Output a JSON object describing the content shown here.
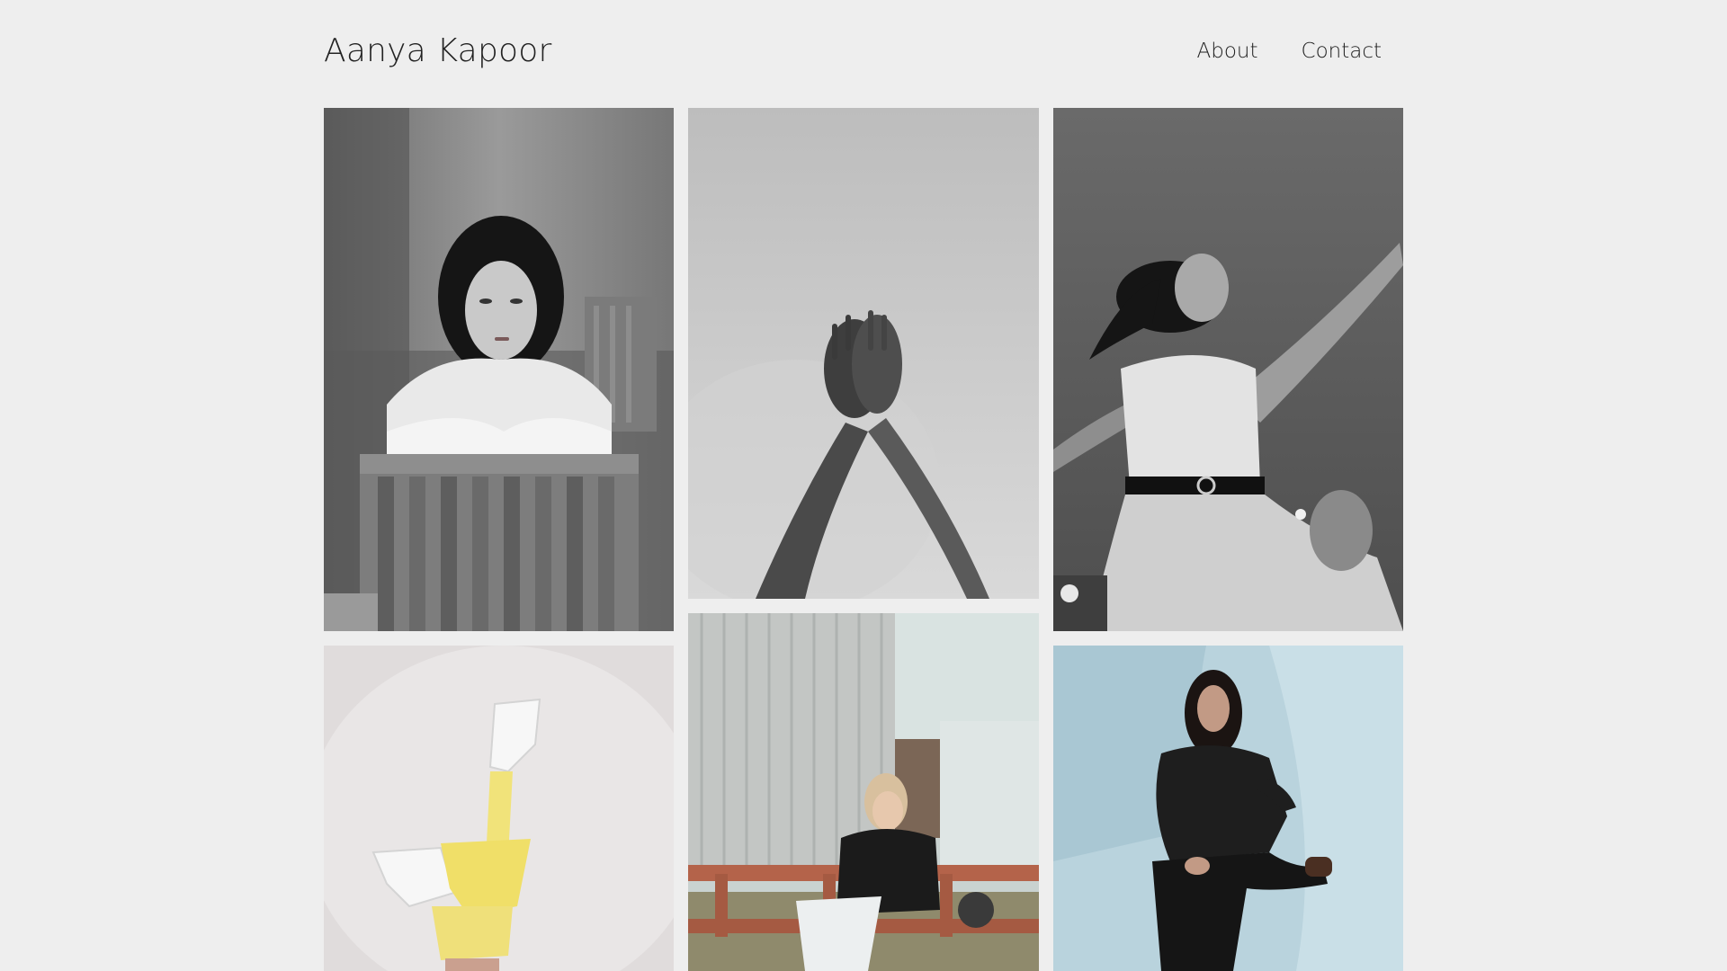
{
  "header": {
    "site_title": "Aanya Kapoor",
    "nav": [
      {
        "label": "About"
      },
      {
        "label": "Contact"
      }
    ]
  },
  "gallery": {
    "photos": [
      {
        "description": "woman-on-wooden-chair-bw"
      },
      {
        "description": "crossed-hands-raised-bw"
      },
      {
        "description": "woman-dancing-outdoors-bw"
      },
      {
        "description": "legs-yellow-pants-white-boots"
      },
      {
        "description": "woman-sitting-on-trailer"
      },
      {
        "description": "woman-posing-blue-backdrop"
      }
    ]
  },
  "colors": {
    "background": "#eeeeee",
    "text": "#222222"
  }
}
